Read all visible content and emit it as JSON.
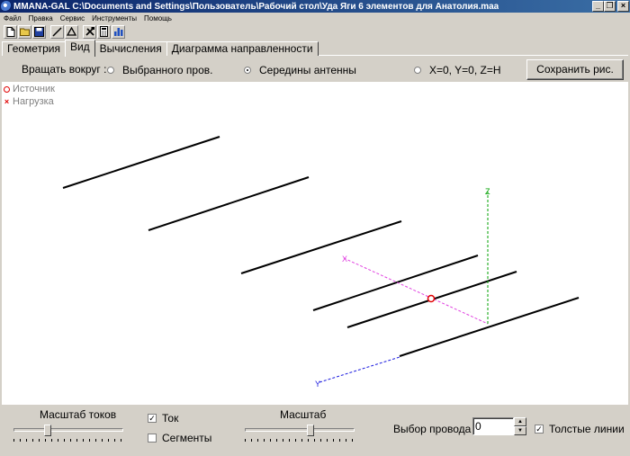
{
  "window": {
    "title": "MMANA-GAL C:\\Documents and Settings\\Пользователь\\Рабочий стол\\Уда Яги 6 элементов для Анатолия.maa",
    "minimize": "_",
    "restore": "❐",
    "close": "×"
  },
  "menu": [
    "Файл",
    "Правка",
    "Сервис",
    "Инструменты",
    "Помощь"
  ],
  "toolbar": {
    "new": "new-file-icon",
    "open": "open-folder-icon",
    "save": "save-disk-icon",
    "wire": "wire-line-icon",
    "triangle": "triangle-icon",
    "tools": "tools-icon",
    "calculator": "calculator-icon",
    "chart": "chart-icon"
  },
  "tabs": [
    "Геометрия",
    "Вид",
    "Вычисления",
    "Диаграмма направленности"
  ],
  "rotate": {
    "label": "Вращать вокруг :",
    "options": [
      "Выбранного пров.",
      "Середины антенны",
      "X=0, Y=0, Z=H"
    ],
    "selected": 1,
    "save_button": "Сохранить рис."
  },
  "legend": {
    "source": "Источник",
    "load": "Нагрузка",
    "source_color": "#e00000"
  },
  "axes": {
    "x": "X",
    "y": "Y",
    "z": "Z"
  },
  "bottom": {
    "current_scale_label": "Масштаб токов",
    "current_label": "Ток",
    "current_checked": true,
    "segments_label": "Сегменты",
    "segments_checked": false,
    "scale_label": "Масштаб",
    "wire_select_label": "Выбор провода",
    "wire_select_value": "0",
    "thick_lines_label": "Толстые линии",
    "thick_lines_checked": true
  }
}
